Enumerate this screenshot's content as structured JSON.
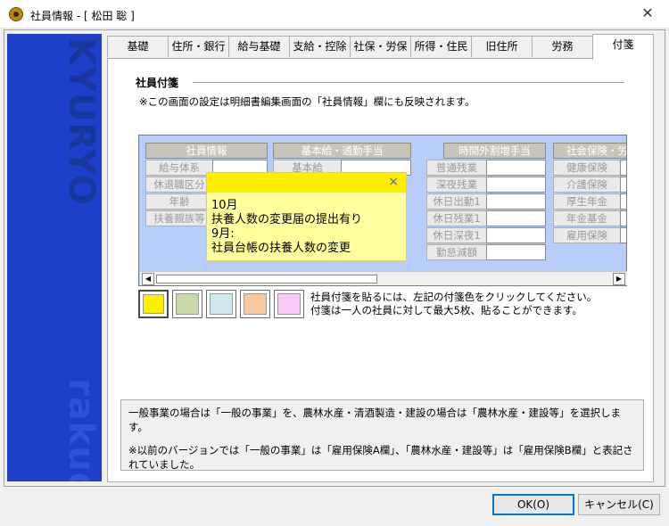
{
  "window": {
    "title": "社員情報 - [ 松田 聡 ]"
  },
  "sidebar": {
    "brand_top": "KYURYO",
    "brand_bottom": "rakuda"
  },
  "tabs": [
    {
      "label": "基礎"
    },
    {
      "label": "住所・銀行"
    },
    {
      "label": "給与基礎"
    },
    {
      "label": "支給・控除"
    },
    {
      "label": "社保・労保"
    },
    {
      "label": "所得・住民"
    },
    {
      "label": "旧住所"
    },
    {
      "label": "労務"
    },
    {
      "label": "付箋"
    }
  ],
  "section": {
    "title": "社員付箋",
    "note": "※この画面の設定は明細書編集画面の「社員情報」欄にも反映されます。"
  },
  "preview": {
    "groups": [
      {
        "title": "社員情報",
        "labels": [
          "給与体系",
          "休退職区分",
          "年齢",
          "扶養親族等"
        ]
      },
      {
        "title": "基本給・通勤手当",
        "labels": [
          "基本給"
        ]
      },
      {
        "title": "時間外割増手当",
        "labels": [
          "普通残業",
          "深夜残業",
          "休日出勤1",
          "休日残業1",
          "休日深夜1",
          "勤怠減額"
        ]
      },
      {
        "title": "社会保険・労",
        "labels": [
          "健康保険",
          "介護保険",
          "厚生年金",
          "年金基金",
          "雇用保険"
        ]
      }
    ]
  },
  "sticky_note": {
    "close": "×",
    "lines": [
      "10月",
      "扶養人数の変更届の提出有り",
      "9月:",
      "社員台帳の扶養人数の変更"
    ]
  },
  "swatches": [
    {
      "name": "yellow",
      "color": "#ffee00"
    },
    {
      "name": "green",
      "color": "#c8d8a8"
    },
    {
      "name": "blue",
      "color": "#cde8f0"
    },
    {
      "name": "orange",
      "color": "#f8c8a0"
    },
    {
      "name": "pink",
      "color": "#fcc8f8"
    }
  ],
  "swatch_note": {
    "line1": "社員付箋を貼るには、左記の付箋色をクリックしてください。",
    "line2": "付箋は一人の社員に対して最大5枚、貼ることができます。"
  },
  "help": {
    "p1": "一般事業の場合は「一般の事業」を、農林水産・清酒製造・建設の場合は「農林水産・建設等」を選択します。",
    "p2": "※以前のバージョンでは「一般の事業」は「雇用保険A欄」、「農林水産・建設等」は「雇用保険B欄」と表記されていました。"
  },
  "buttons": {
    "ok": "OK(O)",
    "cancel": "キャンセル(C)"
  }
}
